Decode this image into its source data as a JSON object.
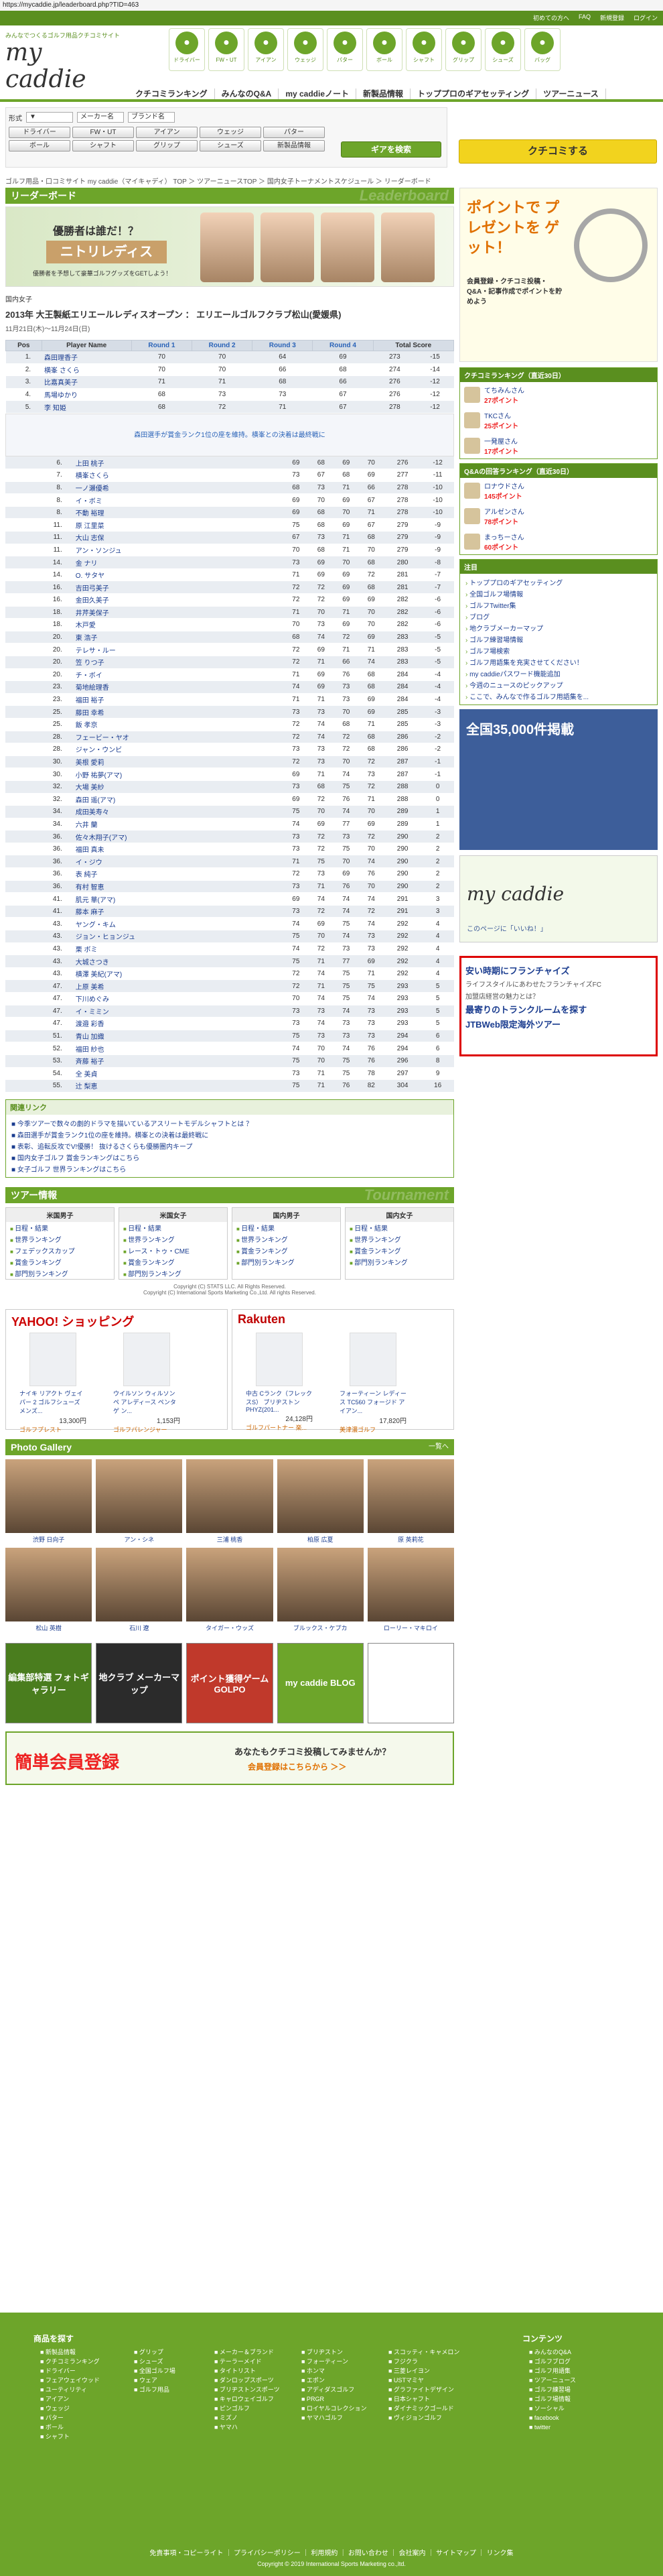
{
  "url": "https://mycaddie.jp/leaderboard.php?TID=463",
  "topbar": {
    "links": [
      "初めての方へ",
      "FAQ",
      "新規登録",
      "ログイン"
    ]
  },
  "logo": {
    "tagline": "みんなでつくるゴルフ用品クチコミサイト",
    "name": "my caddie"
  },
  "nav_icons": [
    "ドライバー",
    "FW・UT",
    "アイアン",
    "ウェッジ",
    "パター",
    "ボール",
    "シャフト",
    "グリップ",
    "シューズ",
    "バッグ"
  ],
  "main_nav": [
    "クチコミランキング",
    "みんなのQ&A",
    "my caddieノート",
    "新製品情報",
    "トッププロのギアセッティング",
    "ツアーニュース"
  ],
  "search": {
    "type_label": "形式",
    "maker_label": "メーカー名",
    "brand_label": "ブランド名",
    "categories": [
      "ドライバー",
      "FW・UT",
      "アイアン",
      "ウェッジ",
      "パター",
      "ボール",
      "シャフト",
      "グリップ",
      "シューズ",
      "新製品情報"
    ],
    "search_button": "ギアを検索",
    "post_button": "クチコミする"
  },
  "breadcrumb": "ゴルフ用品・口コミサイト my caddie（マイキャディ） TOP ＞ ツアーニュースTOP ＞ 国内女子トーナメントスケジュール ＞ リーダーボード",
  "leaderboard": {
    "title": "リーダーボード",
    "ghost": "Leaderboard",
    "banner_l1": "優勝者は誰だ！？",
    "banner_l2": "ニトリレディス",
    "banner_l3": "優勝者を予想して豪華ゴルフグッズをGETしよう！",
    "tour_type": "国内女子",
    "tour_name": "2013年 大王製紙エリエールレディスオープン ： エリエールゴルフクラブ松山(愛媛県)",
    "dates": "11月21日(木)〜11月24日(日)",
    "headers": [
      "Pos",
      "Player Name",
      "Round 1",
      "Round 2",
      "Round 3",
      "Round 4",
      "Total Score"
    ],
    "rows": [
      [
        "1.",
        "森田理香子",
        "70",
        "70",
        "64",
        "69",
        "273",
        "-15"
      ],
      [
        "2.",
        "横峯 さくら",
        "70",
        "70",
        "66",
        "68",
        "274",
        "-14"
      ],
      [
        "3.",
        "比嘉真美子",
        "71",
        "71",
        "68",
        "66",
        "276",
        "-12"
      ],
      [
        "4.",
        "馬場ゆかり",
        "68",
        "73",
        "73",
        "67",
        "276",
        "-12"
      ],
      [
        "5.",
        "李 知姫",
        "68",
        "72",
        "71",
        "67",
        "278",
        "-12"
      ]
    ],
    "notice": "森田選手が賞金ランク1位の座を維持。横峯との決着は最終戦に",
    "rows2": [
      [
        "6.",
        "上田 桃子",
        "69",
        "68",
        "69",
        "70",
        "276",
        "-12"
      ],
      [
        "7.",
        "横峯さくら",
        "73",
        "67",
        "68",
        "69",
        "277",
        "-11"
      ],
      [
        "8.",
        "一ノ瀬優希",
        "68",
        "73",
        "71",
        "66",
        "278",
        "-10"
      ],
      [
        "8.",
        "イ・ボミ",
        "69",
        "70",
        "69",
        "67",
        "278",
        "-10"
      ],
      [
        "8.",
        "不動 裕理",
        "69",
        "68",
        "70",
        "71",
        "278",
        "-10"
      ],
      [
        "11.",
        "原 江里菜",
        "75",
        "68",
        "69",
        "67",
        "279",
        "-9"
      ],
      [
        "11.",
        "大山 志保",
        "67",
        "73",
        "71",
        "68",
        "279",
        "-9"
      ],
      [
        "11.",
        "アン・ソンジュ",
        "70",
        "68",
        "71",
        "70",
        "279",
        "-9"
      ],
      [
        "14.",
        "金 ナリ",
        "73",
        "69",
        "70",
        "68",
        "280",
        "-8"
      ],
      [
        "14.",
        "O. サタヤ",
        "71",
        "69",
        "69",
        "72",
        "281",
        "-7"
      ],
      [
        "16.",
        "吉田弓美子",
        "72",
        "72",
        "69",
        "68",
        "281",
        "-7"
      ],
      [
        "16.",
        "金田久美子",
        "72",
        "72",
        "69",
        "69",
        "282",
        "-6"
      ],
      [
        "18.",
        "井芹美保子",
        "71",
        "70",
        "71",
        "70",
        "282",
        "-6"
      ],
      [
        "18.",
        "木戸愛",
        "70",
        "73",
        "69",
        "70",
        "282",
        "-6"
      ],
      [
        "20.",
        "東 浩子",
        "68",
        "74",
        "72",
        "69",
        "283",
        "-5"
      ],
      [
        "20.",
        "テレサ・ルー",
        "72",
        "69",
        "71",
        "71",
        "283",
        "-5"
      ],
      [
        "20.",
        "笠 りつ子",
        "72",
        "71",
        "66",
        "74",
        "283",
        "-5"
      ],
      [
        "20.",
        "チ・ボイ",
        "71",
        "69",
        "76",
        "68",
        "284",
        "-4"
      ],
      [
        "23.",
        "菊地絵理香",
        "74",
        "69",
        "73",
        "68",
        "284",
        "-4"
      ],
      [
        "23.",
        "福田 裕子",
        "71",
        "71",
        "73",
        "69",
        "284",
        "-4"
      ],
      [
        "25.",
        "藤田 幸希",
        "73",
        "73",
        "70",
        "69",
        "285",
        "-3"
      ],
      [
        "25.",
        "飯 孝京",
        "72",
        "74",
        "68",
        "71",
        "285",
        "-3"
      ],
      [
        "28.",
        "フェービー・ヤオ",
        "72",
        "74",
        "72",
        "68",
        "286",
        "-2"
      ],
      [
        "28.",
        "ジャン・ウンビ",
        "73",
        "73",
        "72",
        "68",
        "286",
        "-2"
      ],
      [
        "30.",
        "美根 愛莉",
        "72",
        "73",
        "70",
        "72",
        "287",
        "-1"
      ],
      [
        "30.",
        "小野 祐夢(アマ)",
        "69",
        "71",
        "74",
        "73",
        "287",
        "-1"
      ],
      [
        "32.",
        "大場 美紗",
        "73",
        "68",
        "75",
        "72",
        "288",
        "0"
      ],
      [
        "32.",
        "森田 遥(アマ)",
        "69",
        "72",
        "76",
        "71",
        "288",
        "0"
      ],
      [
        "34.",
        "成田美寿々",
        "75",
        "70",
        "74",
        "70",
        "289",
        "1"
      ],
      [
        "34.",
        "六井 蘭",
        "74",
        "69",
        "77",
        "69",
        "289",
        "1"
      ],
      [
        "36.",
        "佐々木翔子(アマ)",
        "73",
        "72",
        "73",
        "72",
        "290",
        "2"
      ],
      [
        "36.",
        "福田 真未",
        "73",
        "72",
        "75",
        "70",
        "290",
        "2"
      ],
      [
        "36.",
        "イ・ジウ",
        "71",
        "75",
        "70",
        "74",
        "290",
        "2"
      ],
      [
        "36.",
        "表 純子",
        "72",
        "73",
        "69",
        "76",
        "290",
        "2"
      ],
      [
        "36.",
        "有村 智恵",
        "73",
        "71",
        "76",
        "70",
        "290",
        "2"
      ],
      [
        "41.",
        "肌元 華(アマ)",
        "69",
        "74",
        "74",
        "74",
        "291",
        "3"
      ],
      [
        "41.",
        "藤本 麻子",
        "73",
        "72",
        "74",
        "72",
        "291",
        "3"
      ],
      [
        "43.",
        "ヤング・キム",
        "74",
        "69",
        "75",
        "74",
        "292",
        "4"
      ],
      [
        "43.",
        "ジョン・ヒョンジュ",
        "75",
        "70",
        "74",
        "73",
        "292",
        "4"
      ],
      [
        "43.",
        "栗 ボミ",
        "74",
        "72",
        "73",
        "73",
        "292",
        "4"
      ],
      [
        "43.",
        "大城さつき",
        "75",
        "71",
        "77",
        "69",
        "292",
        "4"
      ],
      [
        "43.",
        "横澤 美紀(アマ)",
        "72",
        "74",
        "75",
        "71",
        "292",
        "4"
      ],
      [
        "47.",
        "上原 美希",
        "72",
        "71",
        "75",
        "75",
        "293",
        "5"
      ],
      [
        "47.",
        "下川めぐみ",
        "70",
        "74",
        "75",
        "74",
        "293",
        "5"
      ],
      [
        "47.",
        "イ・ミミン",
        "73",
        "73",
        "74",
        "73",
        "293",
        "5"
      ],
      [
        "47.",
        "渡邉 彩香",
        "73",
        "74",
        "73",
        "73",
        "293",
        "5"
      ],
      [
        "51.",
        "青山 加織",
        "75",
        "73",
        "73",
        "73",
        "294",
        "6"
      ],
      [
        "52.",
        "福田 紗也",
        "74",
        "70",
        "74",
        "76",
        "294",
        "6"
      ],
      [
        "53.",
        "斉藤 裕子",
        "75",
        "70",
        "75",
        "76",
        "296",
        "8"
      ],
      [
        "54.",
        "全 美貞",
        "73",
        "71",
        "75",
        "78",
        "297",
        "9"
      ],
      [
        "55.",
        "辻 梨恵",
        "75",
        "71",
        "76",
        "82",
        "304",
        "16"
      ]
    ]
  },
  "related": {
    "title": "関連リンク",
    "items": [
      "今季ツアーで数々の劇的ドラマを描いているアスリートモデルシャフトとは ？",
      "森田選手が賞金ランク1位の座を維持。横峯との決着は最終戦に",
      "表彰、追転反攻でV!優勝！ 抜けるさくらも優勝圏内キープ",
      "国内女子ゴルフ 賞金ランキングはこちら",
      "女子ゴルフ 世界ランキングはこちら"
    ]
  },
  "tour_info": {
    "title": "ツアー情報",
    "ghost": "Tournament",
    "cols": [
      {
        "h": "米国男子",
        "items": [
          "日程・結果",
          "世界ランキング",
          "フェデックスカップ",
          "賞金ランキング",
          "部門別ランキング"
        ]
      },
      {
        "h": "米国女子",
        "items": [
          "日程・結果",
          "世界ランキング",
          "レース・トゥ・CME",
          "賞金ランキング",
          "部門別ランキング"
        ]
      },
      {
        "h": "国内男子",
        "items": [
          "日程・結果",
          "世界ランキング",
          "賞金ランキング",
          "部門別ランキング"
        ]
      },
      {
        "h": "国内女子",
        "items": [
          "日程・結果",
          "世界ランキング",
          "賞金ランキング",
          "部門別ランキング"
        ]
      }
    ],
    "copy1": "Copyright (C) STATS LLC. All Rights Reserved.",
    "copy2": "Copyright (C) International Sports Marketing Co.,Ltd. All rights Reserved."
  },
  "shop": {
    "yahoo": {
      "logo": "YAHOO! ショッピング",
      "products": [
        {
          "name": "ナイキ リアクト ヴェイパー 2 ゴルフシューズ メンズ...",
          "price": "13,300円",
          "store": "ゴルフプレスト"
        },
        {
          "name": "ウイルソン ウィルソンペ アレディース ペンタゲ ン...",
          "price": "1,153円",
          "store": "ゴルフパレンジャー"
        }
      ]
    },
    "rakuten": {
      "logo": "Rakuten",
      "products": [
        {
          "name": "中古 Cランク（フレックスS） ブリヂストン PHYZ(201...",
          "price": "24,128円",
          "store": "ゴルフパートナー 楽..."
        },
        {
          "name": "フォーティーン レディース TC560 フォージド アイアン...",
          "price": "17,820円",
          "store": "美津濃ゴルフ"
        }
      ]
    }
  },
  "photo": {
    "title": "Photo Gallery",
    "more": "一覧へ",
    "names": [
      "渋野 日向子",
      "アン・シネ",
      "三浦 桃香",
      "柏原 広夏",
      "原 英莉花",
      "松山 英樹",
      "石川 遼",
      "タイガー・ウッズ",
      "ブルックス・ケプカ",
      "ローリー・マキロイ"
    ]
  },
  "banners": [
    "編集部特選 フォトギャラリー",
    "地クラブ メーカーマップ",
    "ポイント獲得ゲーム GOLPO",
    "my caddie BLOG",
    ""
  ],
  "register": {
    "a": "簡単会員登録",
    "b": "あなたもクチコミ投稿してみませんか？",
    "c": "会員登録はこちらから ＞＞"
  },
  "sidebar": {
    "ad_title": "ポイントで プレゼントを ゲット！",
    "ad_sub": "会員登録・クチコミ投稿・Q&A・記事作成でポイントを貯めよう",
    "rank1_title": "クチコミランキング（直近30日）",
    "rank1": [
      [
        "てちみんさん",
        "27ポイント"
      ],
      [
        "TKCさん",
        "25ポイント"
      ],
      [
        "一発屋さん",
        "17ポイント"
      ]
    ],
    "rank2_title": "Q&Aの回答ランキング（直近30日）",
    "rank2": [
      [
        "ロナウドさん",
        "145ポイント"
      ],
      [
        "アルゼンさん",
        "78ポイント"
      ],
      [
        "まっちーさん",
        "60ポイント"
      ]
    ],
    "menu_title": "注目",
    "menu": [
      "トッププロのギアセッティング",
      "全国ゴルフ場情報",
      "ゴルフTwitter集",
      "ブログ",
      "地クラブメーカーマップ",
      "ゴルフ練習場情報",
      "ゴルフ場検索",
      "ゴルフ用語集を充実させてください！",
      "my caddieパスワード機能追加",
      "今週のニュースのピックアップ",
      "ここで、みんなで作るゴルフ用語集を..."
    ],
    "golf_ad": "全国35,000件掲載",
    "fb": "このページに「いいね！」",
    "ad_lines": [
      "安い時期にフランチャイズ",
      "ライフスタイルにあわせたフランチャイズFC",
      "加盟店経営の魅力とは？",
      "最寄りのトランクルームを探す",
      "JTBWeb限定海外ツアー"
    ]
  },
  "footer": {
    "h1": "商品を探す",
    "h2": "コンテンツ",
    "col1": [
      "新製品情報",
      "クチコミランキング",
      "ドライバー",
      "フェアウェイウッド",
      "ユーティリティ",
      "アイアン",
      "ウェッジ",
      "パター",
      "ボール",
      "シャフト"
    ],
    "col2": [
      "グリップ",
      "シューズ",
      "全国ゴルフ場",
      "ウェア",
      "ゴルフ用品"
    ],
    "col3": [
      "メーカー＆ブランド",
      "テーラーメイド",
      "タイトリスト",
      "ダンロップスポーツ",
      "ブリヂストンスポーツ",
      "キャロウェイゴルフ",
      "ピンゴルフ",
      "ミズノ",
      "ヤマハ"
    ],
    "col4": [
      "ブリヂストン",
      "フォーティーン",
      "ホンマ",
      "エポン",
      "アディダスゴルフ",
      "PRGR",
      "ロイヤルコレクション",
      "ヤマハゴルフ"
    ],
    "col5": [
      "スコッティ・キャメロン",
      "フジクラ",
      "三菱レイヨン",
      "USTマミヤ",
      "グラファイトデザイン",
      "日本シャフト",
      "ダイナミックゴールド",
      "ヴィジョンゴルフ"
    ],
    "col6": [
      "みんなのQ&A",
      "ゴルフブログ",
      "ゴルフ用語集",
      "ツアーニュース",
      "ゴルフ練習場",
      "ゴルフ場情報",
      "ソーシャル",
      "facebook",
      "twitter"
    ],
    "links": "免責事項・コピーライト ｜ プライバシーポリシー ｜ 利用規約 ｜ お問い合わせ ｜ 会社案内 ｜ サイトマップ ｜ リンク集",
    "copy": "Copyright © 2019 International Sports Marketing co.,ltd."
  }
}
